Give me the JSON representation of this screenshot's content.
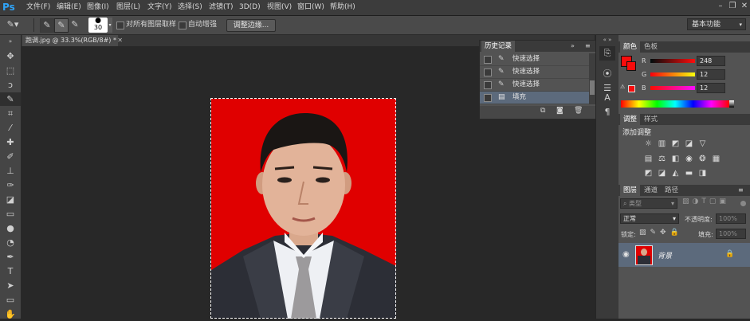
{
  "app": {
    "logo": "Ps"
  },
  "menu": [
    "文件(F)",
    "编辑(E)",
    "图像(I)",
    "图层(L)",
    "文字(Y)",
    "选择(S)",
    "滤镜(T)",
    "3D(D)",
    "视图(V)",
    "窗口(W)",
    "帮助(H)"
  ],
  "window_controls": {
    "minimize": "–",
    "restore": "❐",
    "close": "✕"
  },
  "options": {
    "brush_size": "30",
    "sample_all_layers": "对所有图层取样",
    "auto_enhance": "自动增强",
    "refine_edge": "调整边缘...",
    "workspace": "基本功能"
  },
  "document": {
    "tab_title": "跑调.jpg @ 33.3%(RGB/8#) *"
  },
  "history": {
    "title": "历史记录",
    "items": [
      {
        "label": "快速选择",
        "selected": false
      },
      {
        "label": "快速选择",
        "selected": false
      },
      {
        "label": "快速选择",
        "selected": false
      },
      {
        "label": "填充",
        "selected": true
      }
    ]
  },
  "color_panel": {
    "tabs": [
      "颜色",
      "色板"
    ],
    "channels": [
      {
        "name": "R",
        "value": "248"
      },
      {
        "name": "G",
        "value": "12"
      },
      {
        "name": "B",
        "value": "12"
      }
    ],
    "foreground_color": "#f80c0c"
  },
  "adjust_panel": {
    "tabs": [
      "调整",
      "样式"
    ],
    "title": "添加调整"
  },
  "layers_panel": {
    "tabs": [
      "图层",
      "通道",
      "路径"
    ],
    "filter_label": "类型",
    "blend_mode": "正常",
    "opacity_label": "不透明度:",
    "opacity_value": "100%",
    "lock_label": "锁定:",
    "fill_label": "填充:",
    "fill_value": "100%",
    "layer_name": "背景"
  },
  "colors": {
    "accent": "#2fa3f7",
    "photo_bg": "#e00000",
    "panel": "#535353",
    "selected_row": "#5c6a7c"
  }
}
